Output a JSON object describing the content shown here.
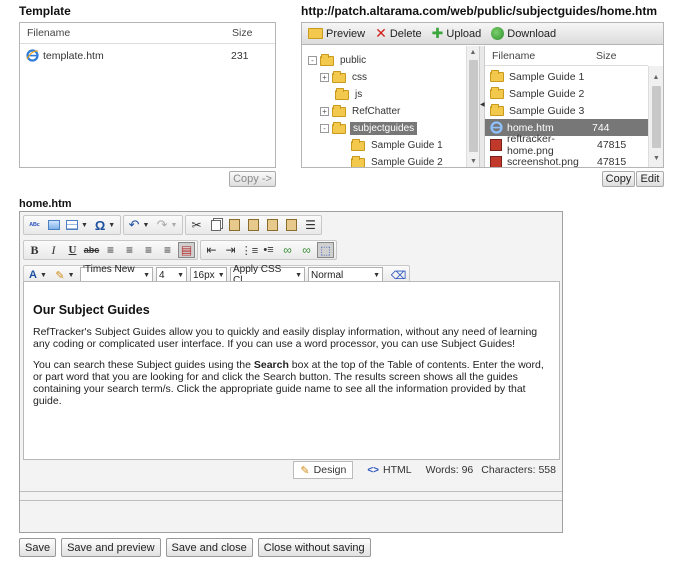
{
  "template_panel": {
    "title": "Template",
    "col_filename": "Filename",
    "col_size": "Size",
    "files": [
      {
        "name": "template.htm",
        "size": "231"
      }
    ],
    "copy_button": "Copy ->"
  },
  "remote_panel": {
    "url": "http://patch.altarama.com/web/public/subjectguides/home.htm",
    "toolbar": {
      "preview": "Preview",
      "delete": "Delete",
      "upload": "Upload",
      "download": "Download"
    },
    "tree": [
      {
        "label": "public",
        "exp": "-"
      },
      {
        "label": "css",
        "exp": "+"
      },
      {
        "label": "js",
        "exp": ""
      },
      {
        "label": "RefChatter",
        "exp": "+"
      },
      {
        "label": "subjectguides",
        "exp": "-"
      },
      {
        "label": "Sample Guide 1",
        "exp": ""
      },
      {
        "label": "Sample Guide 2",
        "exp": ""
      }
    ],
    "col_filename": "Filename",
    "col_size": "Size",
    "files": [
      {
        "name": "Sample Guide 1",
        "size": ""
      },
      {
        "name": "Sample Guide 2",
        "size": ""
      },
      {
        "name": "Sample Guide 3",
        "size": ""
      },
      {
        "name": "home.htm",
        "size": "744"
      },
      {
        "name": "reftracker-home.png",
        "size": "47815"
      },
      {
        "name": "screenshot.png",
        "size": "47815"
      }
    ],
    "copy_button": "Copy",
    "edit_button": "Edit"
  },
  "editor": {
    "title": "home.htm",
    "toolbar": {
      "font_family": "'Times New ...",
      "font_size": "4",
      "font_px": "16px",
      "css_class": "Apply CSS Cl...",
      "block_format": "Normal"
    },
    "content": {
      "heading": "Our Subject Guides",
      "para1": "RefTracker's Subject Guides allow you to quickly and easily display information, without any need of learning any coding or complicated user interface. If you can use a word processor, you can use Subject Guides!",
      "para2_before": "You can search these Subject guides using the ",
      "para2_bold": "Search",
      "para2_after": " box at the top of the Table of contents.  Enter the word, or part word that you are looking for and click the Search button.  The results screen shows all the guides containing your search term/s.  Click the appropriate guide name to see all the information provided by that guide."
    },
    "status": {
      "design": "Design",
      "html": "HTML",
      "words": "Words: 96",
      "characters": "Characters: 558"
    }
  },
  "actions": {
    "save": "Save",
    "save_preview": "Save and preview",
    "save_close": "Save and close",
    "close_nosave": "Close without saving"
  },
  "colors": {
    "selected_row": "#777777",
    "ie_icon": "#2e7cd6"
  }
}
